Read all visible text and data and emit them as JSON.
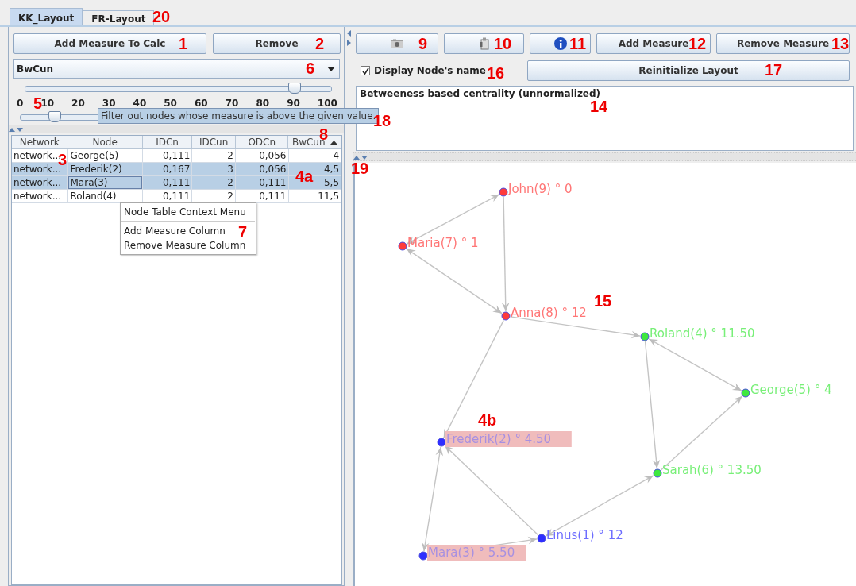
{
  "tabs": [
    {
      "label": "KK_Layout",
      "selected": true
    },
    {
      "label": "FR-Layout",
      "selected": false
    }
  ],
  "left_panel": {
    "buttons": [
      "Add Measure To Calc",
      "Remove"
    ],
    "measure_dropdown": {
      "value": "BwCun"
    },
    "range_slider": {
      "level": 0.88,
      "ticks": [
        "0",
        "10",
        "20",
        "30",
        "40",
        "50",
        "60",
        "70",
        "80",
        "90",
        "100"
      ]
    },
    "filter_slider": {
      "level": 0.11
    },
    "table": {
      "columns": [
        {
          "label": "Network",
          "sorted": false
        },
        {
          "label": "Node",
          "sorted": false
        },
        {
          "label": "IDCn",
          "sorted": false
        },
        {
          "label": "IDCun",
          "sorted": false
        },
        {
          "label": "ODCn",
          "sorted": false
        },
        {
          "label": "BwCun",
          "sorted": true
        }
      ],
      "rows": [
        {
          "cells": [
            "network...",
            "George(5)",
            "0,111",
            "2",
            "0,056",
            "4"
          ],
          "selected": false,
          "focused": false
        },
        {
          "cells": [
            "network...",
            "Frederik(2)",
            "0,167",
            "3",
            "0,056",
            "4,5"
          ],
          "selected": true,
          "focused": false
        },
        {
          "cells": [
            "network...",
            "Mara(3)",
            "0,111",
            "2",
            "0,111",
            "5,5"
          ],
          "selected": true,
          "focused": true
        },
        {
          "cells": [
            "network...",
            "Roland(4)",
            "0,111",
            "2",
            "0,111",
            "11,5"
          ],
          "selected": false,
          "focused": false
        }
      ]
    },
    "context_menu": {
      "title": "Node Table Context Menu",
      "items": [
        "Add Measure Column",
        "Remove Measure Column"
      ]
    },
    "tooltip": {
      "text": "Filter out nodes whose measure is above the given value."
    }
  },
  "right_panel": {
    "toolbar": [
      {
        "kind": "camera"
      },
      {
        "kind": "plugin"
      },
      {
        "kind": "info"
      },
      {
        "kind": "text",
        "label": "Add Measure"
      },
      {
        "kind": "text",
        "label": "Remove Measure"
      }
    ],
    "display_names": {
      "label": "Display Node's name",
      "checked": true
    },
    "reinitialize_button": "Reinitialize Layout",
    "description": "Betweeness based centrality (unnormalized)",
    "graph": {
      "nodes": [
        {
          "label": "John(9) ° 0",
          "color": "#ff3b3b",
          "highlighted": false
        },
        {
          "label": "Maria(7) ° 1",
          "color": "#ff3b3b",
          "highlighted": false
        },
        {
          "label": "Anna(8) ° 12",
          "color": "#ff3b3b",
          "highlighted": false
        },
        {
          "label": "Roland(4) ° 11.50",
          "color": "#3ee83e",
          "highlighted": false
        },
        {
          "label": "George(5) ° 4",
          "color": "#3ee83e",
          "highlighted": false
        },
        {
          "label": "Frederik(2) ° 4.50",
          "color": "#2e2eff",
          "highlighted": true
        },
        {
          "label": "Sarah(6) ° 13.50",
          "color": "#3ee83e",
          "highlighted": false
        },
        {
          "label": "Linus(1) ° 12",
          "color": "#2e2eff",
          "highlighted": false
        },
        {
          "label": "Mara(3) ° 5.50",
          "color": "#2e2eff",
          "highlighted": true
        }
      ]
    }
  },
  "callouts": [
    "20",
    "1",
    "2",
    "6",
    "5",
    "18",
    "8",
    "3",
    "4a",
    "7",
    "9",
    "10",
    "11",
    "12",
    "13",
    "16",
    "17",
    "14",
    "19",
    "15",
    "4b"
  ]
}
